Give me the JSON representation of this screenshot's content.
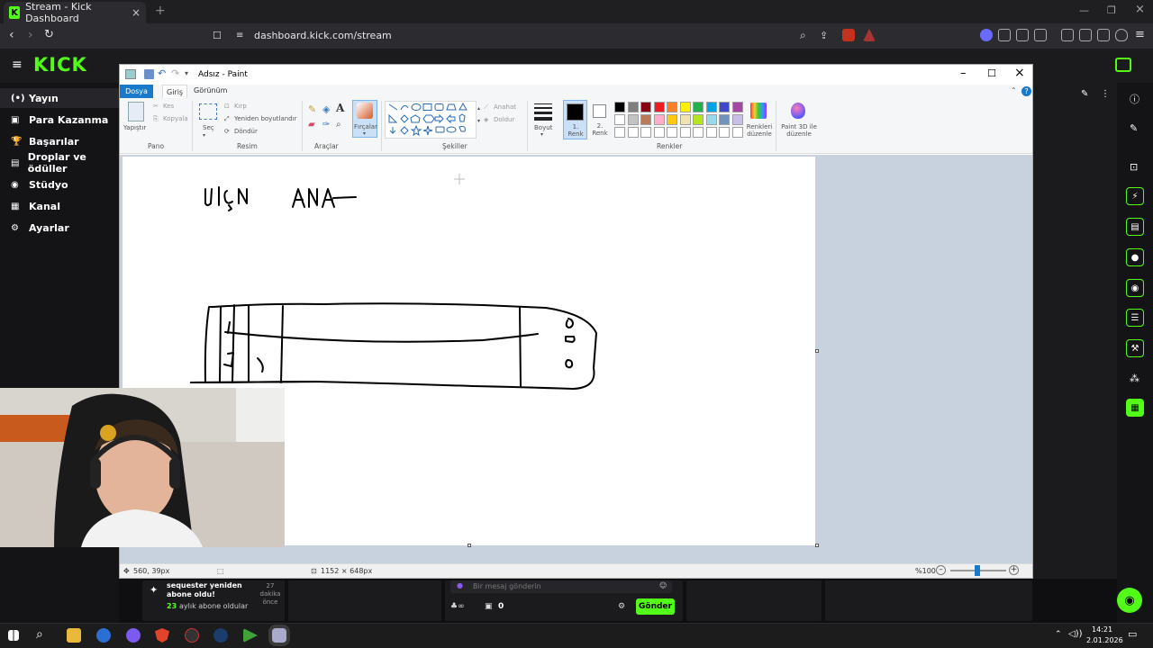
{
  "browser": {
    "tab_title": "Stream - Kick Dashboard",
    "tab_fav": "K",
    "url": "dashboard.kick.com/stream",
    "new_tab": "+",
    "close": "×",
    "minimize": "—",
    "restore": "❐"
  },
  "kick": {
    "logo": "KICK",
    "sidebar": [
      {
        "icon": "(•)",
        "label": "Yayın"
      },
      {
        "icon": "▣",
        "label": "Para Kazanma"
      },
      {
        "icon": "🏆",
        "label": "Başarılar"
      },
      {
        "icon": "▤",
        "label": "Droplar ve ödüller"
      },
      {
        "icon": "◉",
        "label": "Stüdyo"
      },
      {
        "icon": "▦",
        "label": "Kanal"
      },
      {
        "icon": "⚙",
        "label": "Ayarlar"
      }
    ],
    "notification": {
      "title": "sequester yeniden abone oldu!",
      "time": "27 dakika önce",
      "months_number": "23",
      "months_text": "aylık abone oldular"
    },
    "chat": {
      "placeholder": "Bir mesaj gönderin",
      "count": "0",
      "send_label": "Gönder"
    }
  },
  "paint": {
    "title": "Adsız - Paint",
    "tabs": {
      "file": "Dosya",
      "home": "Giriş",
      "view": "Görünüm"
    },
    "ribbon": {
      "paste": "Yapıştır",
      "cut": "Kes",
      "copy": "Kopyala",
      "clipboard_group": "Pano",
      "select": "Seç",
      "crop": "Kırp",
      "resize": "Yeniden boyutlandır",
      "rotate": "Döndür",
      "image_group": "Resim",
      "tools_group": "Araçlar",
      "brushes": "Fırçalar",
      "outline": "Anahat",
      "fill": "Doldur",
      "shapes_group": "Şekiller",
      "size": "Boyut",
      "color1": "1. Renk",
      "color2": "2. Renk",
      "edit_colors": "Renkleri düzenle",
      "paint3d": "Paint 3D ile düzenle",
      "colors_group": "Renkler"
    },
    "palette": [
      "#000000",
      "#7f7f7f",
      "#880015",
      "#ed1c24",
      "#ff7f27",
      "#fff200",
      "#22b14c",
      "#00a2e8",
      "#3f48cc",
      "#a349a4",
      "#ffffff",
      "#c3c3c3",
      "#b97a57",
      "#ffaec9",
      "#ffc90e",
      "#efe4b0",
      "#b5e61d",
      "#99d9ea",
      "#7092be",
      "#c8bfe7"
    ],
    "status": {
      "cursor_pos": "560, 39px",
      "canvas_size": "1152 × 648px",
      "zoom": "%100"
    }
  },
  "taskbar": {
    "time": "14:21",
    "date": "2.01.2026"
  }
}
